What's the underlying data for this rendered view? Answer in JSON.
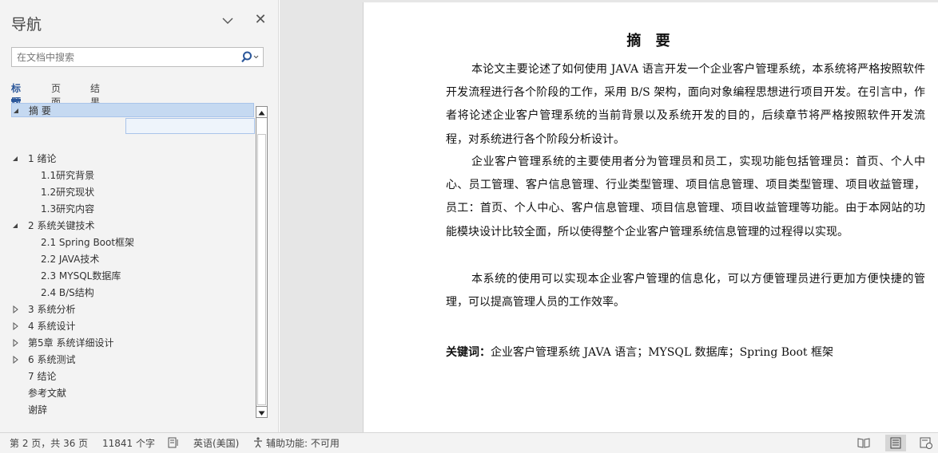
{
  "nav": {
    "title": "导航",
    "search_placeholder": "在文档中搜索",
    "tabs": [
      {
        "label": "标题",
        "active": true
      },
      {
        "label": "页面",
        "active": false
      },
      {
        "label": "结果",
        "active": false
      }
    ],
    "tree": [
      {
        "label": "摘 要",
        "level": 1,
        "arrow": "expanded",
        "selected": true
      },
      {
        "label": "1 绪论",
        "level": 1,
        "arrow": "expanded"
      },
      {
        "label": "1.1研究背景",
        "level": 2
      },
      {
        "label": "1.2研究现状",
        "level": 2
      },
      {
        "label": "1.3研究内容",
        "level": 2
      },
      {
        "label": "2 系统关键技术",
        "level": 1,
        "arrow": "expanded"
      },
      {
        "label": "2.1 Spring Boot框架",
        "level": 2
      },
      {
        "label": "2.2 JAVA技术",
        "level": 2
      },
      {
        "label": "2.3 MYSQL数据库",
        "level": 2
      },
      {
        "label": "2.4 B/S结构",
        "level": 2
      },
      {
        "label": "3 系统分析",
        "level": 1,
        "arrow": "collapsed"
      },
      {
        "label": "4 系统设计",
        "level": 1,
        "arrow": "collapsed"
      },
      {
        "label": "第5章 系统详细设计",
        "level": 1,
        "arrow": "collapsed"
      },
      {
        "label": "6 系统测试",
        "level": 1,
        "arrow": "collapsed"
      },
      {
        "label": "7 结论",
        "level": 1
      },
      {
        "label": "参考文献",
        "level": 1
      },
      {
        "label": "谢辞",
        "level": 1
      }
    ]
  },
  "document": {
    "title": "摘 要",
    "paragraphs": [
      "本论文主要论述了如何使用 JAVA 语言开发一个企业客户管理系统，本系统将严格按照软件开发流程进行各个阶段的工作，采用 B/S 架构，面向对象编程思想进行项目开发。在引言中，作者将论述企业客户管理系统的当前背景以及系统开发的目的，后续章节将严格按照软件开发流程，对系统进行各个阶段分析设计。",
      "企业客户管理系统的主要使用者分为管理员和员工，实现功能包括管理员：首页、个人中心、员工管理、客户信息管理、行业类型管理、项目信息管理、项目类型管理、项目收益管理，员工：首页、个人中心、客户信息管理、项目信息管理、项目收益管理等功能。由于本网站的功能模块设计比较全面，所以使得整个企业客户管理系统信息管理的过程得以实现。",
      "本系统的使用可以实现本企业客户管理的信息化，可以方便管理员进行更加方便快捷的管理，可以提高管理人员的工作效率。"
    ],
    "keywords_label": "关键词：",
    "keywords_text": "企业客户管理系统 JAVA 语言；MYSQL 数据库；Spring  Boot 框架"
  },
  "status": {
    "page": "第 2 页，共 36 页",
    "words": "11841 个字",
    "language": "英语(美国)",
    "accessibility": "辅助功能: 不可用"
  },
  "colors": {
    "accent": "#2b579a",
    "selection": "#c5d9f1",
    "nav_bg": "#f3f3f3"
  }
}
